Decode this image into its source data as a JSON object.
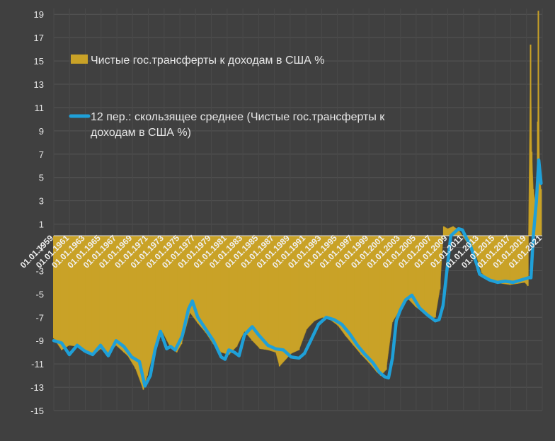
{
  "chart_data": {
    "type": "bar",
    "title": "",
    "xlabel": "",
    "ylabel": "",
    "ylim": [
      -15,
      19.5
    ],
    "yticks": [
      19,
      17,
      15,
      13,
      11,
      9,
      7,
      5,
      3,
      1,
      -1,
      -3,
      -5,
      -7,
      -9,
      -11,
      -13,
      -15
    ],
    "xticks": [
      "01.01.1959",
      "01.01.1961",
      "01.01.1963",
      "01.01.1965",
      "01.01.1967",
      "01.01.1969",
      "01.01.1971",
      "01.01.1973",
      "01.01.1975",
      "01.01.1977",
      "01.01.1979",
      "01.01.1981",
      "01.01.1983",
      "01.01.1985",
      "01.01.1987",
      "01.01.1989",
      "01.01.1991",
      "01.01.1993",
      "01.01.1995",
      "01.01.1997",
      "01.01.1999",
      "01.01.2001",
      "01.01.2003",
      "01.01.2005",
      "01.01.2007",
      "01.01.2009",
      "01.01.2011",
      "01.01.2013",
      "01.01.2015",
      "01.01.2017",
      "01.01.2019",
      "01.01.2021"
    ],
    "x_range": [
      1959,
      2021.75
    ],
    "grid": true,
    "legend_position": "top-left",
    "colors": {
      "bars": "#C9A227",
      "moving_average": "#1FA0D8",
      "background": "#404040",
      "grid": "#555555",
      "text": "#E6E6E6",
      "zero_line": "#E0E0E0"
    },
    "series": [
      {
        "name": "Чистые гос.трансферты к доходам в США %",
        "kind": "bar",
        "x": [
          1959.0,
          1960.0,
          1961.0,
          1962.0,
          1963.0,
          1964.0,
          1965.0,
          1966.0,
          1967.0,
          1968.0,
          1968.5,
          1969.5,
          1970.5,
          1971.0,
          1972.0,
          1973.0,
          1974.0,
          1974.8,
          1975.4,
          1976.5,
          1977.5,
          1978.5,
          1979.5,
          1980.5,
          1981.5,
          1982.5,
          1983.5,
          1984.5,
          1985.5,
          1986.5,
          1987.5,
          1988.0,
          1989.5,
          1990.5,
          1991.5,
          1992.5,
          1993.5,
          1994.5,
          1995.5,
          1996.5,
          1997.5,
          1998.5,
          1999.5,
          2000.5,
          2001.0,
          2001.7,
          2002.5,
          2003.5,
          2004.5,
          2005.5,
          2006.5,
          2007.5,
          2008.0,
          2008.6,
          2009.1,
          2009.6,
          2010.3,
          2011.0,
          2011.7,
          2012.5,
          2013.3,
          2014.0,
          2014.8,
          2015.7,
          2016.6,
          2017.6,
          2018.6,
          2019.5,
          2019.9,
          2020.25,
          2020.4,
          2020.6,
          2020.8,
          2021.0,
          2021.17,
          2021.25,
          2021.4,
          2021.6
        ],
        "values": [
          -8.8,
          -9.8,
          -9.4,
          -9.5,
          -10.0,
          -10.3,
          -9.7,
          -10.1,
          -9.4,
          -10.0,
          -10.3,
          -11.4,
          -13.2,
          -12.0,
          -9.5,
          -8.3,
          -9.6,
          -10.0,
          -9.3,
          -6.6,
          -7.5,
          -8.3,
          -9.3,
          -10.0,
          -10.2,
          -9.5,
          -8.2,
          -9.0,
          -9.7,
          -9.8,
          -10.0,
          -11.2,
          -10.1,
          -9.8,
          -8.0,
          -7.3,
          -7.0,
          -7.2,
          -7.7,
          -8.6,
          -9.4,
          -10.2,
          -10.9,
          -11.7,
          -12.0,
          -11.5,
          -7.4,
          -6.3,
          -5.4,
          -6.1,
          -6.6,
          -7.1,
          -7.0,
          -4.6,
          0.8,
          0.6,
          0.8,
          0.5,
          -0.2,
          -1.0,
          -1.8,
          -3.2,
          -3.8,
          -4.0,
          -4.1,
          -4.2,
          -4.1,
          -4.0,
          -4.3,
          16.4,
          7.2,
          4.0,
          3.1,
          2.0,
          9.8,
          19.3,
          5.5,
          4.0
        ]
      },
      {
        "name": "12 пер.: скользящее среднее (Чистые гос.трансферты к доходам в США %)",
        "kind": "line",
        "x": [
          1959.0,
          1960.0,
          1961.0,
          1962.0,
          1963.0,
          1964.0,
          1965.0,
          1966.0,
          1967.0,
          1968.0,
          1969.0,
          1970.0,
          1970.7,
          1971.4,
          1972.0,
          1972.7,
          1973.5,
          1974.0,
          1974.6,
          1975.5,
          1976.3,
          1976.8,
          1977.5,
          1978.5,
          1979.5,
          1980.5,
          1981.0,
          1981.5,
          1982.2,
          1982.8,
          1983.5,
          1984.5,
          1985.3,
          1986.5,
          1987.5,
          1988.5,
          1989.5,
          1990.5,
          1991.2,
          1992.0,
          1993.0,
          1994.0,
          1995.0,
          1996.0,
          1997.0,
          1998.0,
          1999.0,
          2000.0,
          2000.8,
          2001.5,
          2002.0,
          2002.5,
          2003.0,
          2003.5,
          2004.2,
          2005.0,
          2006.0,
          2007.0,
          2008.0,
          2008.5,
          2009.0,
          2009.5,
          2010.0,
          2010.5,
          2011.0,
          2011.5,
          2012.0,
          2012.5,
          2013.0,
          2013.4,
          2013.7,
          2014.2,
          2015.0,
          2016.0,
          2017.0,
          2018.0,
          2019.0,
          2020.0,
          2020.3,
          2020.6,
          2021.0,
          2021.3,
          2021.6
        ],
        "values": [
          -9.0,
          -9.2,
          -10.2,
          -9.4,
          -9.9,
          -10.2,
          -9.4,
          -10.3,
          -9.0,
          -9.5,
          -10.4,
          -10.8,
          -12.9,
          -12.0,
          -9.8,
          -8.2,
          -9.7,
          -9.5,
          -9.8,
          -8.6,
          -6.3,
          -5.6,
          -7.0,
          -8.0,
          -9.0,
          -10.4,
          -10.6,
          -9.8,
          -10.0,
          -10.3,
          -8.5,
          -7.8,
          -8.5,
          -9.4,
          -9.7,
          -9.8,
          -10.4,
          -10.5,
          -10.1,
          -9.0,
          -7.6,
          -7.0,
          -7.2,
          -7.6,
          -8.4,
          -9.4,
          -10.2,
          -10.9,
          -11.7,
          -12.1,
          -12.2,
          -10.5,
          -7.3,
          -6.4,
          -5.5,
          -5.1,
          -6.2,
          -6.8,
          -7.3,
          -7.2,
          -6.0,
          -3.0,
          0.0,
          0.3,
          0.6,
          0.5,
          -0.2,
          -0.8,
          -1.8,
          -2.6,
          -3.3,
          -3.5,
          -3.8,
          -4.0,
          -3.9,
          -4.0,
          -3.8,
          -3.6,
          -3.6,
          0.0,
          3.0,
          6.5,
          4.5
        ]
      }
    ]
  }
}
